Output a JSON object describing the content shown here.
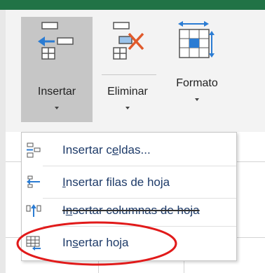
{
  "ribbon": {
    "insert_label": "Insertar",
    "delete_label": "Eliminar",
    "format_label": "Formato"
  },
  "menu": {
    "items": [
      {
        "label_pre": "Insertar c",
        "label_u": "e",
        "label_post": "ldas...",
        "icon": "insert-cells-icon"
      },
      {
        "label_pre": "",
        "label_u": "I",
        "label_post": "nsertar filas de hoja",
        "icon": "insert-rows-icon"
      },
      {
        "label_pre": "I",
        "label_u": "n",
        "label_post": "sertar columnas de hoja",
        "icon": "insert-columns-icon"
      },
      {
        "label_pre": "In",
        "label_u": "s",
        "label_post": "ertar hoja",
        "icon": "insert-sheet-icon"
      }
    ]
  },
  "colors": {
    "excel_green": "#217346",
    "menu_text": "#1e3b69",
    "highlight": "#e11a1a"
  }
}
